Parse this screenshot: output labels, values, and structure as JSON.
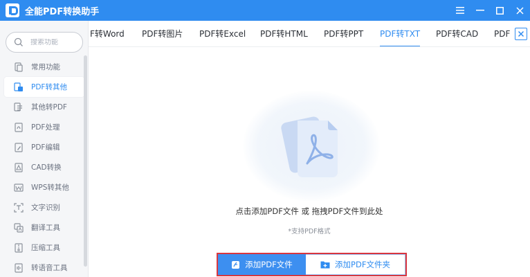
{
  "app": {
    "title": "全能PDF转换助手"
  },
  "window_controls": [
    "menu-icon",
    "minimize-icon",
    "maximize-icon",
    "close-icon"
  ],
  "sidebar": {
    "search": {
      "placeholder": "搜索功能"
    },
    "items": [
      {
        "label": "常用功能",
        "icon": "common-icon"
      },
      {
        "label": "PDF转其他",
        "icon": "pdf-convert-icon",
        "active": true
      },
      {
        "label": "其他转PDF",
        "icon": "to-pdf-icon"
      },
      {
        "label": "PDF处理",
        "icon": "pdf-process-icon"
      },
      {
        "label": "PDF编辑",
        "icon": "pdf-edit-icon"
      },
      {
        "label": "CAD转换",
        "icon": "cad-icon"
      },
      {
        "label": "WPS转其他",
        "icon": "wps-icon"
      },
      {
        "label": "文字识别",
        "icon": "ocr-icon"
      },
      {
        "label": "翻译工具",
        "icon": "translate-icon"
      },
      {
        "label": "压缩工具",
        "icon": "compress-icon"
      },
      {
        "label": "转语音工具",
        "icon": "speech-icon"
      }
    ]
  },
  "tabs": [
    {
      "label": "F转Word"
    },
    {
      "label": "PDF转图片"
    },
    {
      "label": "PDF转Excel"
    },
    {
      "label": "PDF转HTML"
    },
    {
      "label": "PDF转PPT"
    },
    {
      "label": "PDF转TXT",
      "active": true
    },
    {
      "label": "PDF转CAD"
    },
    {
      "label": "PDF"
    }
  ],
  "main": {
    "drop_text": "点击添加PDF文件 或 拖拽PDF文件到此处",
    "support_text": "*支持PDF格式",
    "add_file_button": "添加PDF文件",
    "add_folder_button": "添加PDF文件夹"
  },
  "colors": {
    "accent": "#2f8cf0",
    "highlight_border": "#d9363e"
  }
}
